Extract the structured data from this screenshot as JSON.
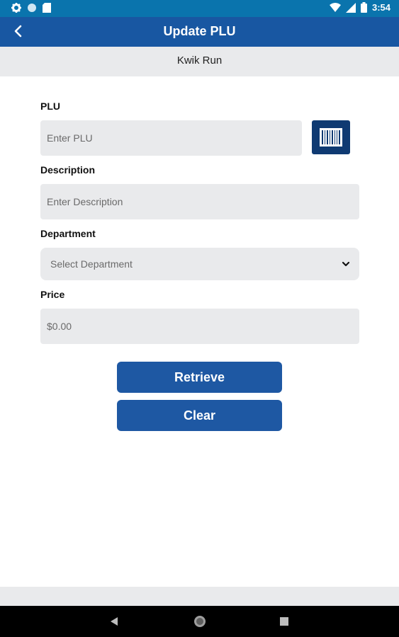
{
  "status_bar": {
    "time": "3:54"
  },
  "app_bar": {
    "title": "Update PLU"
  },
  "store": {
    "name": "Kwik Run"
  },
  "form": {
    "plu": {
      "label": "PLU",
      "placeholder": "Enter PLU"
    },
    "description": {
      "label": "Description",
      "placeholder": "Enter Description"
    },
    "department": {
      "label": "Department",
      "selected": "Select Department"
    },
    "price": {
      "label": "Price",
      "value": "$0.00"
    }
  },
  "buttons": {
    "retrieve": "Retrieve",
    "clear": "Clear"
  },
  "colors": {
    "status_bar": "#0a74ad",
    "app_bar": "#1857a2",
    "primary_button": "#1e58a3",
    "scan_button": "#0f3a72",
    "field_bg": "#e9eaec"
  },
  "icons": [
    "settings-icon",
    "circle-icon",
    "sd-card-icon",
    "wifi-icon",
    "signal-icon",
    "battery-icon",
    "back-arrow-icon",
    "barcode-icon",
    "chevron-down-icon",
    "nav-back-icon",
    "nav-home-icon",
    "nav-recents-icon"
  ]
}
